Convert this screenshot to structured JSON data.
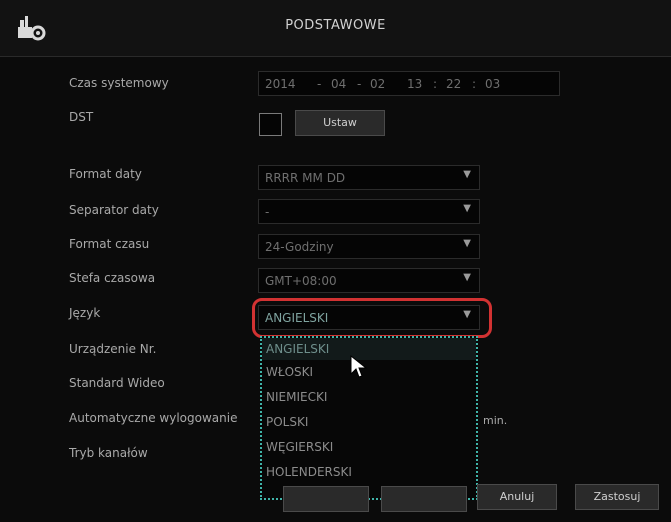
{
  "window": {
    "title": "PODSTAWOWE"
  },
  "form": {
    "rows": [
      {
        "label": "Czas systemowy"
      },
      {
        "label": "DST"
      },
      {
        "label": "Format daty"
      },
      {
        "label": "Separator daty"
      },
      {
        "label": "Format czasu"
      },
      {
        "label": "Stefa czasowa"
      },
      {
        "label": "Język"
      },
      {
        "label": "Urządzenie Nr."
      },
      {
        "label": "Standard Wideo"
      },
      {
        "label": "Automatyczne wylogowanie"
      },
      {
        "label": "Tryb kanałów"
      }
    ],
    "system_time": {
      "year": "2014",
      "sep1": "-",
      "month": "04",
      "sep2": "-",
      "day": "02",
      "hour": "13",
      "sep3": ":",
      "minute": "22",
      "sep4": ":",
      "second": "03"
    },
    "dst_button": "Ustaw",
    "date_format": "RRRR MM DD",
    "date_separator": "-",
    "time_format": "24-Godziny",
    "time_zone": "GMT+08:00",
    "language": "ANGIELSKI",
    "autologout_unit": "min."
  },
  "language_dropdown": {
    "options": [
      "ANGIELSKI",
      "WŁOSKI",
      "NIEMIECKI",
      "POLSKI",
      "WĘGIERSKI",
      "HOLENDERSKI"
    ]
  },
  "buttons": {
    "cancel": "Anuluj",
    "apply": "Zastosuj"
  },
  "icons": {
    "app": "settings-tools-icon",
    "dropdown": "triangle-down-icon",
    "cursor": "mouse-pointer-icon"
  },
  "colors": {
    "highlight_ring": "#d23232",
    "dropdown_border": "#3fb4a9"
  }
}
